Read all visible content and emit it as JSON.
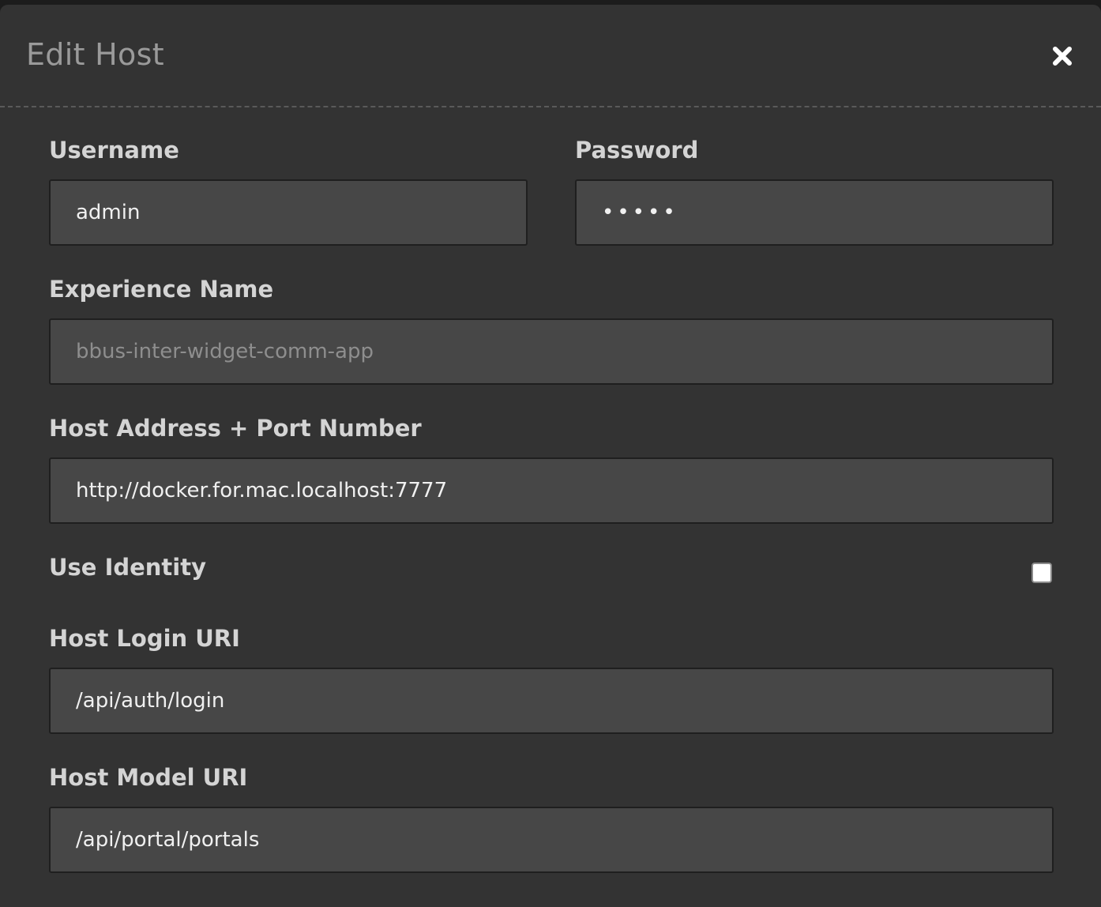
{
  "dialog": {
    "title": "Edit Host",
    "close_icon": "close-icon"
  },
  "form": {
    "username": {
      "label": "Username",
      "value": "admin"
    },
    "password": {
      "label": "Password",
      "value": "•••••"
    },
    "experience_name": {
      "label": "Experience Name",
      "placeholder": "bbus-inter-widget-comm-app"
    },
    "host_address": {
      "label": "Host Address + Port Number",
      "value": "http://docker.for.mac.localhost:7777"
    },
    "use_identity": {
      "label": "Use Identity",
      "checked": false
    },
    "host_login_uri": {
      "label": "Host Login URI",
      "value": "/api/auth/login"
    },
    "host_model_uri": {
      "label": "Host Model URI",
      "value": "/api/portal/portals"
    }
  },
  "colors": {
    "dialog_bg": "#333333",
    "input_bg": "#474747",
    "label_text": "#d4d4d4",
    "title_text": "#9a9a9a"
  }
}
